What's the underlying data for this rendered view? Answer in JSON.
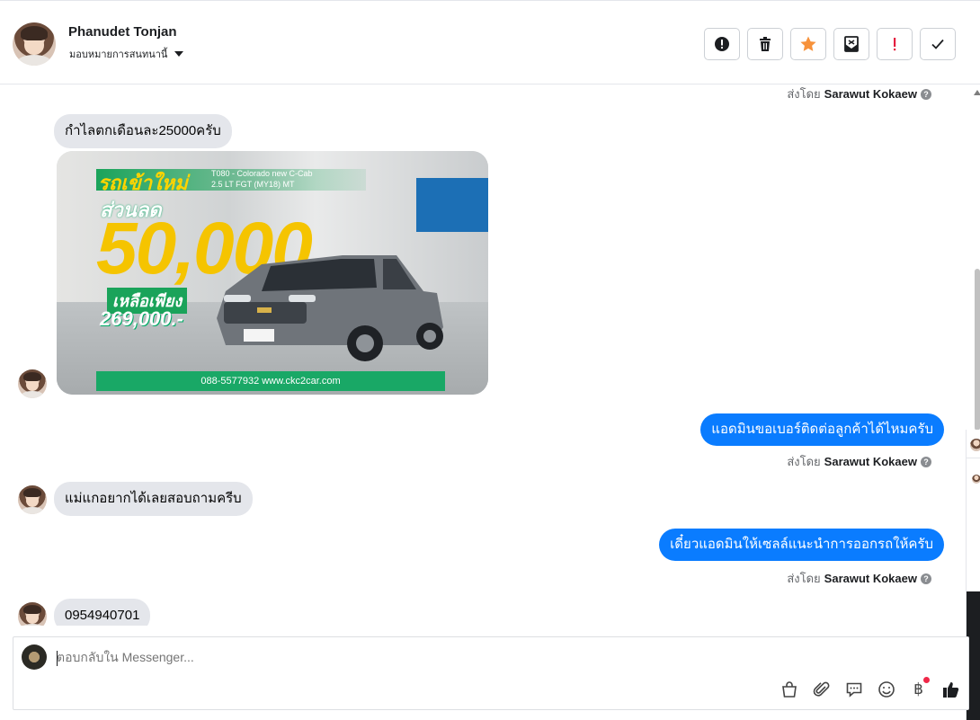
{
  "header": {
    "name": "Phanudet Tonjan",
    "assign_label": "มอบหมายการสนทนานี้",
    "actions": [
      {
        "icon": "exclamation-circle-icon"
      },
      {
        "icon": "trash-icon"
      },
      {
        "icon": "star-icon",
        "color": "#f7923b"
      },
      {
        "icon": "mark-unread-icon"
      },
      {
        "icon": "spam-icon",
        "color": "#e41e3f"
      },
      {
        "icon": "check-icon"
      }
    ]
  },
  "thread": {
    "sent_by_prefix": "ส่งโดย",
    "sender": "Sarawut Kokaew",
    "info_glyph": "?",
    "messages": [
      {
        "direction": "in",
        "text": "กำไลตกเดือนละ25000ครับ"
      },
      {
        "direction": "in",
        "type": "image"
      },
      {
        "direction": "out",
        "text": "แอดมินขอเบอร์ติดต่อลูกค้าได้ไหมครับ"
      },
      {
        "direction": "in",
        "text": "แม่แกอยากได้เลยสอบถามครีบ"
      },
      {
        "direction": "out",
        "text": "เดี๋ยวแอดมินให้เซลล์แนะนำการออกรถให้ครับ"
      },
      {
        "direction": "in",
        "text": "0954940701"
      }
    ]
  },
  "photo": {
    "headline": "รถเข้าใหม่",
    "spec_line1": "T080 - Colorado new C-Cab",
    "spec_line2": "2.5 LT FGT (MY18) MT",
    "discount_label": "ส่วนลด",
    "discount_value": "50,000",
    "remaining_label": "เหลือเพียง",
    "price": "269,000.-",
    "footer": "088-5577932 www.ckc2car.com"
  },
  "composer": {
    "placeholder": "ตอบกลับใน Messenger...",
    "tools": [
      "shopping-bag-icon",
      "paperclip-icon",
      "saved-replies-icon",
      "emoji-icon",
      "baht-payment-icon",
      "thumbs-up-icon"
    ],
    "baht_glyph": "฿",
    "like_color": "#1c1e21"
  },
  "colors": {
    "outgoing_bubble": "#0a7cff",
    "incoming_bubble": "#e4e6eb",
    "notification_dot": "#f02849"
  }
}
